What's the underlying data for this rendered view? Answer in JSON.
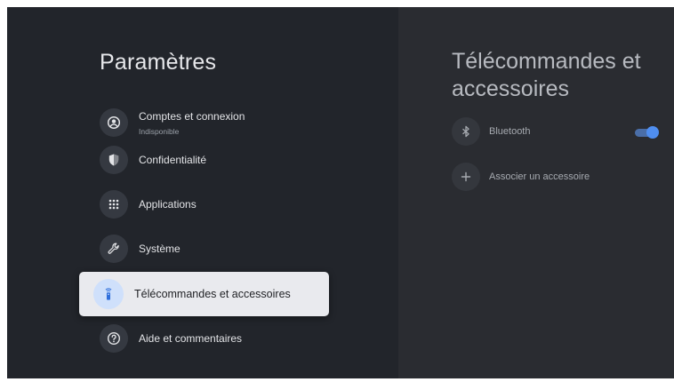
{
  "settings": {
    "title": "Paramètres",
    "items": [
      {
        "label": "Comptes et connexion",
        "sublabel": "Indisponible",
        "icon": "account-circle-icon"
      },
      {
        "label": "Confidentialité",
        "icon": "shield-icon"
      },
      {
        "label": "Applications",
        "icon": "apps-grid-icon"
      },
      {
        "label": "Système",
        "icon": "wrench-icon"
      },
      {
        "label": "Télécommandes et accessoires",
        "icon": "remote-icon",
        "selected": true
      },
      {
        "label": "Aide et commentaires",
        "icon": "help-icon"
      }
    ]
  },
  "detail": {
    "title": "Télécommandes et accessoires",
    "items": [
      {
        "label": "Bluetooth",
        "icon": "bluetooth-icon",
        "toggle": true
      },
      {
        "label": "Associer un accessoire",
        "icon": "plus-icon"
      }
    ]
  },
  "colors": {
    "background": "#22252b",
    "panel_right": "#2a2c31",
    "selected_bg": "#e9eaee",
    "accent": "#4f8ef0"
  }
}
